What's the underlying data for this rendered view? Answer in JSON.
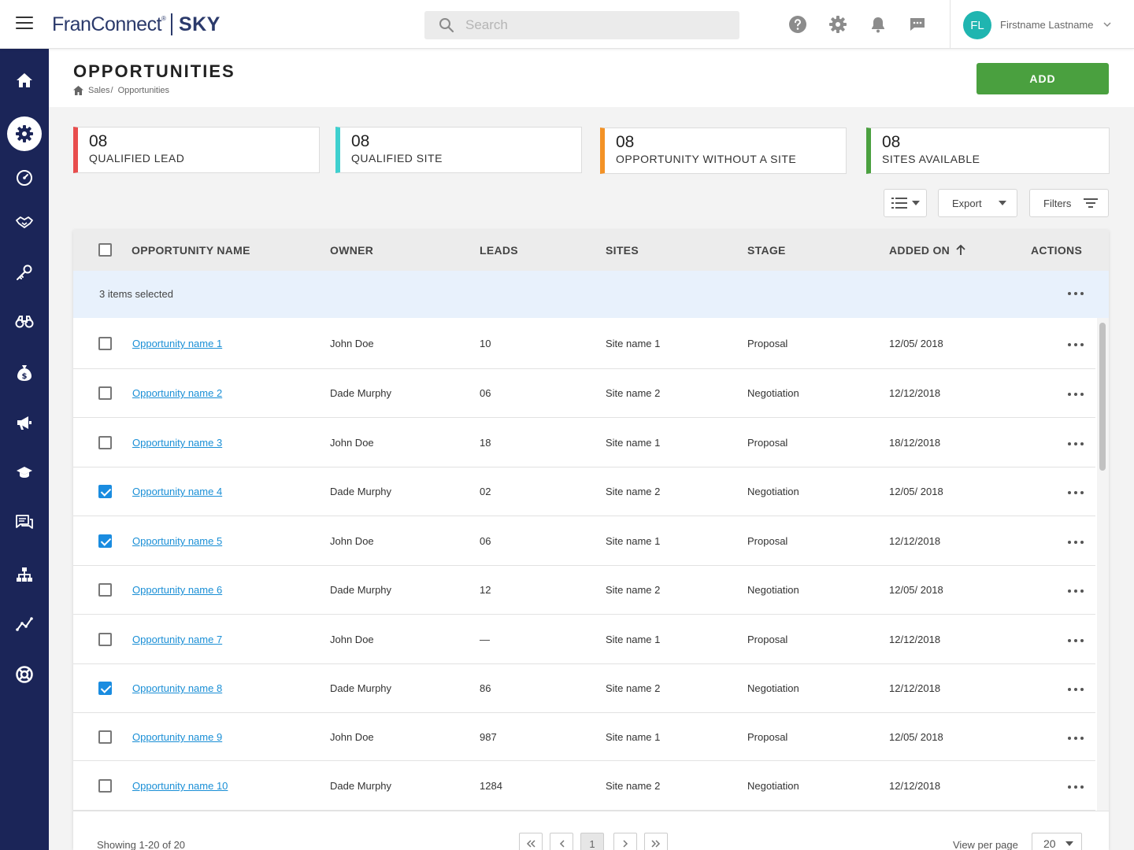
{
  "app": {
    "logo_main": "FranConnect",
    "logo_reg": "®",
    "logo_product": "SKY"
  },
  "topbar": {
    "search_placeholder": "Search",
    "user_initials": "FL",
    "user_name": "Firstname Lastname",
    "icons": [
      "help-icon",
      "settings-icon",
      "bell-icon",
      "chat-icon"
    ]
  },
  "sidebar": {
    "items": [
      "home-icon",
      "gear-icon",
      "dashboard-icon",
      "handshake-icon",
      "key-icon",
      "binoculars-icon",
      "money-bag-icon",
      "megaphone-icon",
      "graduation-cap-icon",
      "messages-icon",
      "org-chart-icon",
      "analytics-icon",
      "support-icon"
    ],
    "active_index": 1
  },
  "page": {
    "title": "OPPORTUNITIES",
    "breadcrumb": [
      "Sales",
      "Opportunities"
    ],
    "breadcrumb_sep": "/",
    "add_label": "ADD"
  },
  "stats": [
    {
      "value": "08",
      "label": "QUALIFIED LEAD",
      "color": "#e84d4d"
    },
    {
      "value": "08",
      "label": "QUALIFIED SITE",
      "color": "#3fd0cf"
    },
    {
      "value": "08",
      "label": "OPPORTUNITY WITHOUT A SITE",
      "color": "#f39226"
    },
    {
      "value": "08",
      "label": "SITES AVAILABLE",
      "color": "#4aa03f"
    }
  ],
  "toolbar": {
    "export_label": "Export",
    "filters_label": "Filters"
  },
  "table": {
    "columns": [
      "OPPORTUNITY NAME",
      "OWNER",
      "LEADS",
      "SITES",
      "STAGE",
      "ADDED ON",
      "ACTIONS"
    ],
    "selection_text": "3 items selected",
    "rows": [
      {
        "name": "Opportunity name 1",
        "owner": "John Doe",
        "leads": "10",
        "site": "Site name 1",
        "stage": "Proposal",
        "added": "12/05/ 2018",
        "checked": false
      },
      {
        "name": "Opportunity name 2",
        "owner": "Dade Murphy",
        "leads": "06",
        "site": "Site name 2",
        "stage": "Negotiation",
        "added": "12/12/2018",
        "checked": false
      },
      {
        "name": "Opportunity name 3",
        "owner": "John Doe",
        "leads": "18",
        "site": "Site name 1",
        "stage": "Proposal",
        "added": "18/12/2018",
        "checked": false
      },
      {
        "name": "Opportunity name 4",
        "owner": "Dade Murphy",
        "leads": "02",
        "site": "Site name 2",
        "stage": "Negotiation",
        "added": "12/05/ 2018",
        "checked": true
      },
      {
        "name": "Opportunity name 5",
        "owner": "John Doe",
        "leads": "06",
        "site": "Site name 1",
        "stage": "Proposal",
        "added": "12/12/2018",
        "checked": true
      },
      {
        "name": "Opportunity name 6",
        "owner": "Dade Murphy",
        "leads": "12",
        "site": "Site name 2",
        "stage": "Negotiation",
        "added": "12/05/ 2018",
        "checked": false
      },
      {
        "name": "Opportunity name 7",
        "owner": "John Doe",
        "leads": "—",
        "site": "Site name 1",
        "stage": "Proposal",
        "added": "12/12/2018",
        "checked": false
      },
      {
        "name": "Opportunity name 8",
        "owner": "Dade Murphy",
        "leads": "86",
        "site": "Site name 2",
        "stage": "Negotiation",
        "added": "12/12/2018",
        "checked": true
      },
      {
        "name": "Opportunity name 9",
        "owner": "John Doe",
        "leads": "987",
        "site": "Site name 1",
        "stage": "Proposal",
        "added": "12/05/ 2018",
        "checked": false
      },
      {
        "name": "Opportunity name 10",
        "owner": "Dade Murphy",
        "leads": "1284",
        "site": "Site name 2",
        "stage": "Negotiation",
        "added": "12/12/2018",
        "checked": false
      }
    ]
  },
  "footer": {
    "showing": "Showing 1-20 of 20",
    "current_page": "1",
    "view_per_page_label": "View per page",
    "view_per_page_value": "20"
  }
}
